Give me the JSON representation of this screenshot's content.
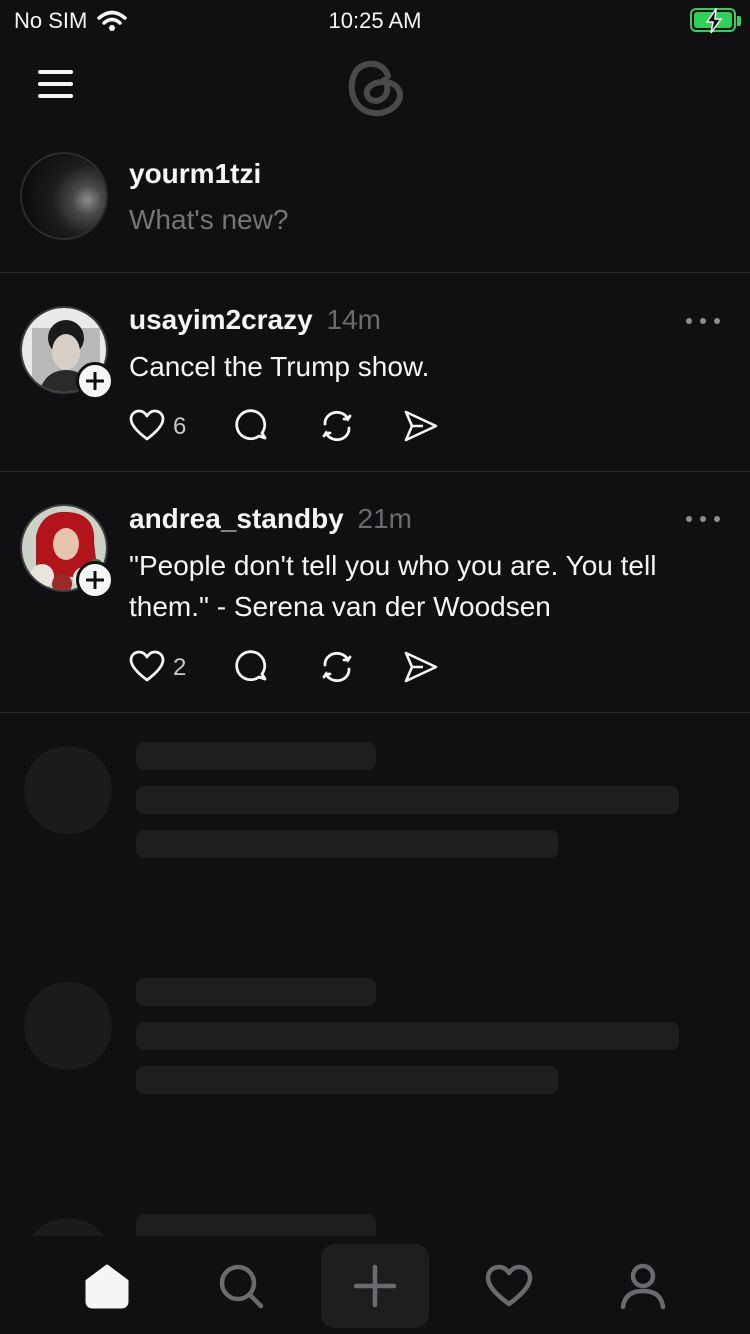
{
  "status_bar": {
    "carrier": "No SIM",
    "time": "10:25 AM",
    "battery_color": "#30d158"
  },
  "header": {
    "logo_icon": "threads-logo-icon",
    "menu_icon": "hamburger-menu-icon"
  },
  "composer": {
    "username": "yourm1tzi",
    "placeholder": "What's new?"
  },
  "posts": [
    {
      "username": "usayim2crazy",
      "time": "14m",
      "text": "Cancel the Trump show.",
      "likes": "6"
    },
    {
      "username": "andrea_standby",
      "time": "21m",
      "text": "\"People don't tell you who you are. You tell them.\" - Serena van der Woodsen",
      "likes": "2"
    }
  ],
  "tabs": [
    {
      "name": "home",
      "icon": "home-icon",
      "active": true
    },
    {
      "name": "search",
      "icon": "search-icon"
    },
    {
      "name": "create",
      "icon": "plus-icon"
    },
    {
      "name": "activity",
      "icon": "heart-icon"
    },
    {
      "name": "profile",
      "icon": "person-icon"
    }
  ],
  "colors": {
    "background": "#101012",
    "text": "#f3f5f7",
    "secondary": "#6a6b6e",
    "divider": "#2a2a2d"
  }
}
